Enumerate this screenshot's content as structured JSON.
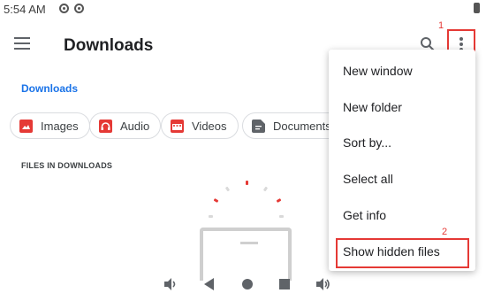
{
  "status_bar": {
    "time": "5:54 AM"
  },
  "toolbar": {
    "title": "Downloads"
  },
  "breadcrumb": {
    "label": "Downloads"
  },
  "chips": [
    {
      "label": "Images",
      "icon": "image-icon",
      "color": "#e53935"
    },
    {
      "label": "Audio",
      "icon": "headphones-icon",
      "color": "#e53935"
    },
    {
      "label": "Videos",
      "icon": "movie-icon",
      "color": "#e53935"
    },
    {
      "label": "Documents",
      "icon": "document-icon",
      "color": "#5f6368"
    }
  ],
  "files": {
    "section_header": "FILES IN DOWNLOADS"
  },
  "menu": {
    "items": [
      {
        "label": "New window"
      },
      {
        "label": "New folder"
      },
      {
        "label": "Sort by..."
      },
      {
        "label": "Select all"
      },
      {
        "label": "Get info"
      },
      {
        "label": "Show hidden files"
      }
    ]
  },
  "annotations": {
    "marker_1": "1",
    "marker_2": "2",
    "color": "#e53935"
  },
  "colors": {
    "accent": "#1a73e8",
    "red": "#e53935"
  }
}
